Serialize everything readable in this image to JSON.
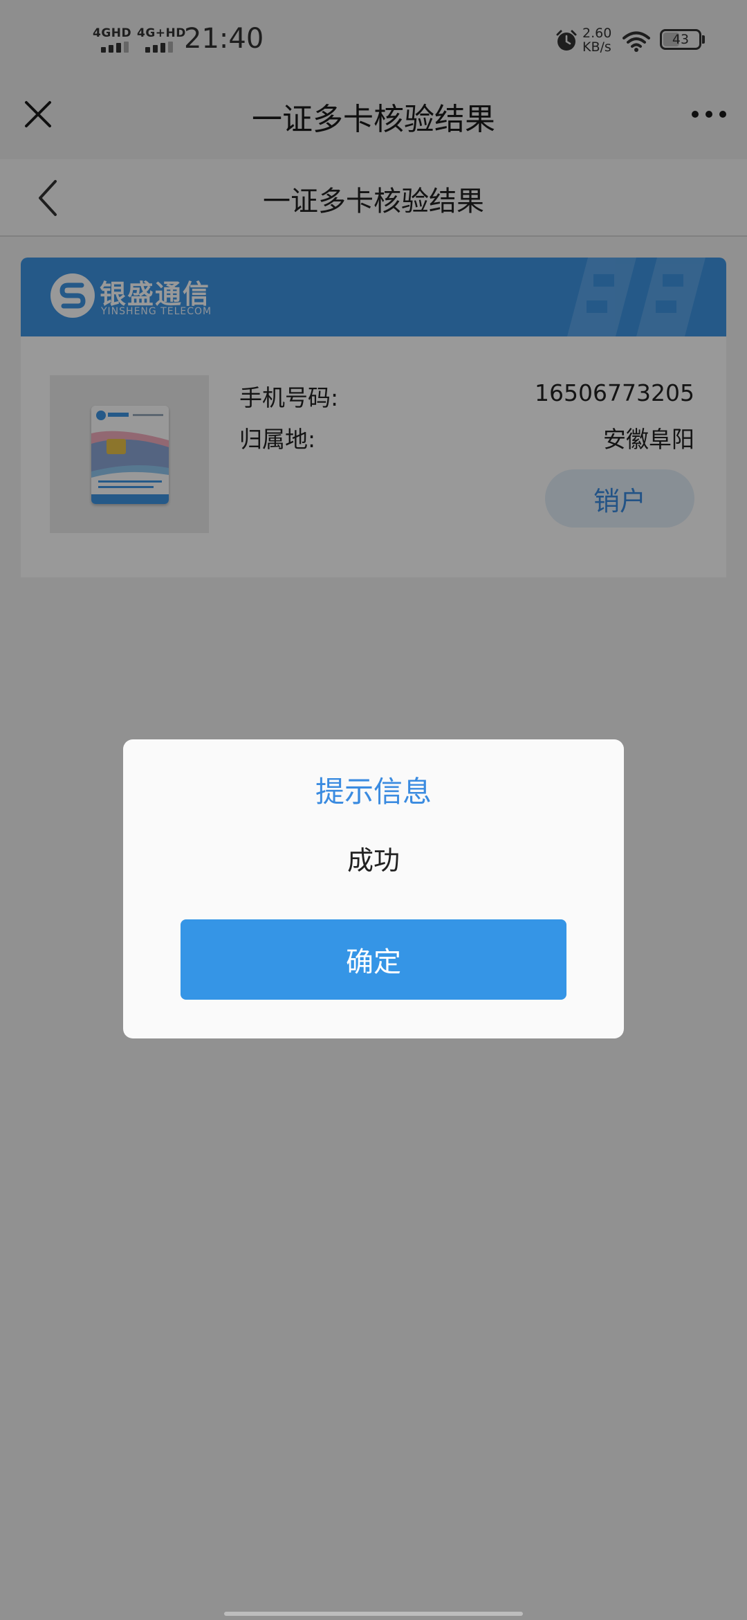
{
  "status_bar": {
    "network1": "4GHD",
    "network2": "4G+HD",
    "time": "21:40",
    "speed_value": "2.60",
    "speed_unit": "KB/s",
    "battery": "43",
    "battery_level": 0.43
  },
  "app_header": {
    "title": "一证多卡核验结果",
    "close_icon": "close-icon",
    "more_icon": "more-icon"
  },
  "page_nav": {
    "title": "一证多卡核验结果",
    "back_icon": "chevron-left-icon"
  },
  "card": {
    "brand_name": "银盛通信",
    "brand_sub": "YINSHENG TELECOM",
    "brand_color": "#3e95e3",
    "phone_label": "手机号码:",
    "phone_value": "16506773205",
    "location_label": "归属地:",
    "location_value": "安徽阜阳",
    "cancel_label": "销户"
  },
  "dialog": {
    "title": "提示信息",
    "message": "成功",
    "confirm_label": "确定",
    "accent": "#3595e6"
  }
}
